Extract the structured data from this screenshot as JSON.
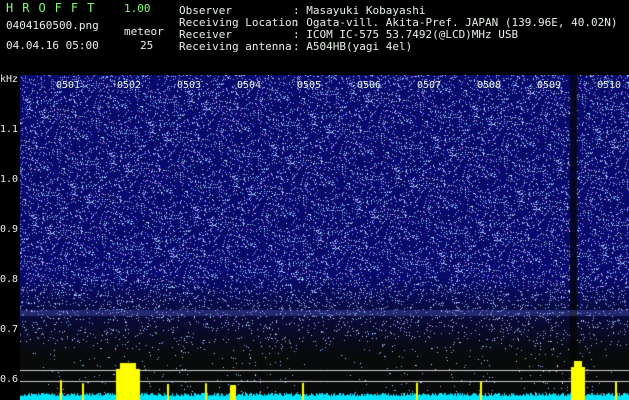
{
  "header": {
    "brand": "HROFFT",
    "version": "1.00",
    "filename": "0404160500.png",
    "datetime": "04.04.16 05:00",
    "meteor_label": "meteor",
    "meteor_count": "25",
    "fields": [
      {
        "label": "Observer",
        "value": ": Masayuki Kobayashi"
      },
      {
        "label": "Receiving Location",
        "value": ": Ogata-vill. Akita-Pref. JAPAN (139.96E, 40.02N)"
      },
      {
        "label": "Receiver",
        "value": ": ICOM IC-575 53.7492(@LCD)MHz USB"
      },
      {
        "label": "Receiving antenna",
        "value": ": A504HB(yagi 4el)"
      }
    ]
  },
  "axis": {
    "unit": "kHz",
    "y_labels": [
      "1.1",
      "1.0",
      "0.9",
      "0.8",
      "0.7",
      "0.6"
    ],
    "x_labels": [
      "0501",
      "0502",
      "0503",
      "0504",
      "0505",
      "0506",
      "0507",
      "0508",
      "0509",
      "0510"
    ]
  },
  "colors": {
    "background": "#000000",
    "spectrogram_base": "#10157a",
    "meteor_echo": "#ff2a55",
    "echo_halo": "#33ff66",
    "level_bars": "#ffff00",
    "noise_floor": "#00e5ff"
  }
}
